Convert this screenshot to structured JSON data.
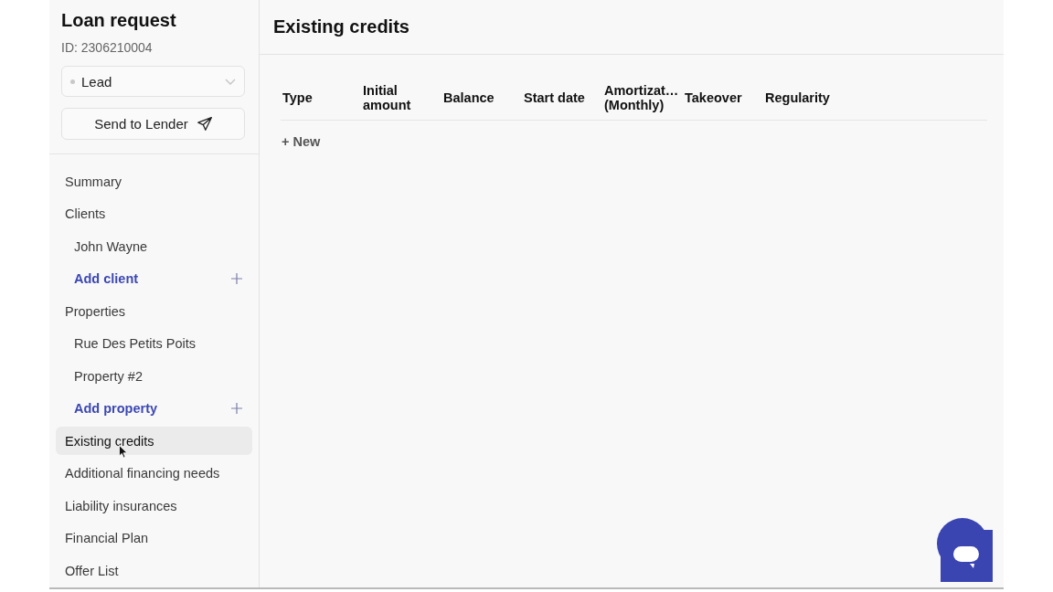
{
  "sidebar": {
    "title": "Loan request",
    "id_label": "ID: 2306210004",
    "status": {
      "value": "Lead",
      "color": "#c8c8c8"
    },
    "send_button": "Send to Lender",
    "items": [
      {
        "label": "Summary",
        "selected": false
      },
      {
        "label": "Clients",
        "selected": false,
        "children": [
          {
            "label": "John Wayne",
            "kind": "entry",
            "selected": false
          },
          {
            "label": "Add client",
            "kind": "add",
            "selected": false
          }
        ]
      },
      {
        "label": "Properties",
        "selected": false,
        "children": [
          {
            "label": "Rue Des Petits Poits",
            "kind": "entry",
            "selected": false
          },
          {
            "label": "Property #2",
            "kind": "entry",
            "selected": false
          },
          {
            "label": "Add property",
            "kind": "add",
            "selected": false
          }
        ]
      },
      {
        "label": "Existing credits",
        "selected": true
      },
      {
        "label": "Additional financing needs",
        "selected": false
      },
      {
        "label": "Liability insurances",
        "selected": false
      },
      {
        "label": "Financial Plan",
        "selected": false
      },
      {
        "label": "Offer List",
        "selected": false
      }
    ]
  },
  "main": {
    "title": "Existing credits",
    "table": {
      "columns": [
        "Type",
        "Initial amount",
        "Balance",
        "Start date",
        "Amortizat… (Monthly)",
        "Takeover",
        "Regularity"
      ]
    },
    "new_button": "+ New"
  }
}
